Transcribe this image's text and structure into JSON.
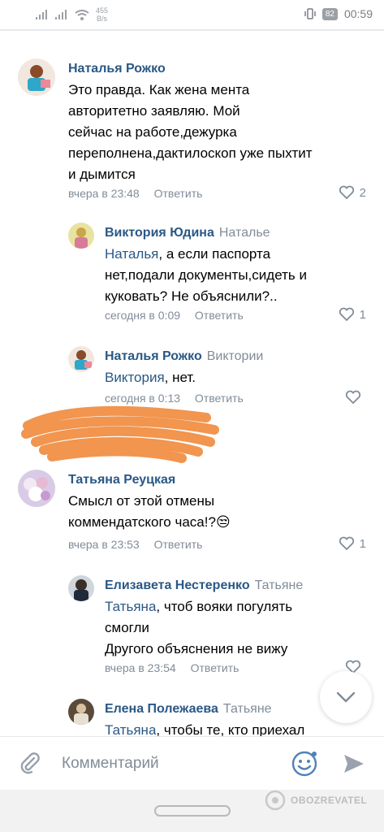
{
  "statusbar": {
    "net_speed_value": "455",
    "net_speed_unit": "B/s",
    "battery": "82",
    "time": "00:59"
  },
  "comments": [
    {
      "author": "Наталья Рожко",
      "reply_to": "",
      "mention": "",
      "text": "Это правда. Как жена мента\nавторитетно заявляю. Мой\nсейчас на работе,дежурка\nпереполнена,дактилоскоп уже пыхтит\nи дымится",
      "time": "вчера в 23:48",
      "reply_label": "Ответить",
      "likes": "2"
    },
    {
      "author": "Виктория Юдина",
      "reply_to": "Наталье",
      "mention": "Наталья",
      "text": ", а если паспорта\nнет,подали документы,сидеть и\nкуковать? Не объяснили?..",
      "time": "сегодня в 0:09",
      "reply_label": "Ответить",
      "likes": "1"
    },
    {
      "author": "Наталья Рожко",
      "reply_to": "Виктории",
      "mention": "Виктория",
      "text": ", нет.",
      "time": "сегодня в 0:13",
      "reply_label": "Ответить",
      "likes": ""
    },
    {
      "author": "Татьяна Реуцкая",
      "reply_to": "",
      "mention": "",
      "text": "Смысл от этой отмены\nкоммендатского часа!?",
      "emoji": "😒",
      "time": "вчера в 23:53",
      "reply_label": "Ответить",
      "likes": "1"
    },
    {
      "author": "Елизавета Нестеренко",
      "reply_to": "Татьяне",
      "mention": "Татьяна",
      "text": ", чтоб вояки погулять\nсмогли\nДругого объяснения не вижу",
      "time": "вчера в 23:54",
      "reply_label": "Ответить",
      "likes": ""
    },
    {
      "author": "Елена Полежаева",
      "reply_to": "Татьяне",
      "mention": "Татьяна",
      "text": ", чтобы те, кто приехал",
      "time": "",
      "reply_label": "",
      "likes": ""
    }
  ],
  "composer": {
    "placeholder": "Комментарий"
  },
  "watermark": "OBOZREVATEL",
  "colors": {
    "link": "#2a5885",
    "secondary": "#818c99",
    "accent_icons": "#5181b8",
    "scribble": "#f08a3c"
  },
  "icons": [
    "signal-icon",
    "wifi-icon",
    "vibrate-icon",
    "battery-icon",
    "heart-icon",
    "chevron-down-icon",
    "attach-icon",
    "smile-icon",
    "send-icon"
  ]
}
